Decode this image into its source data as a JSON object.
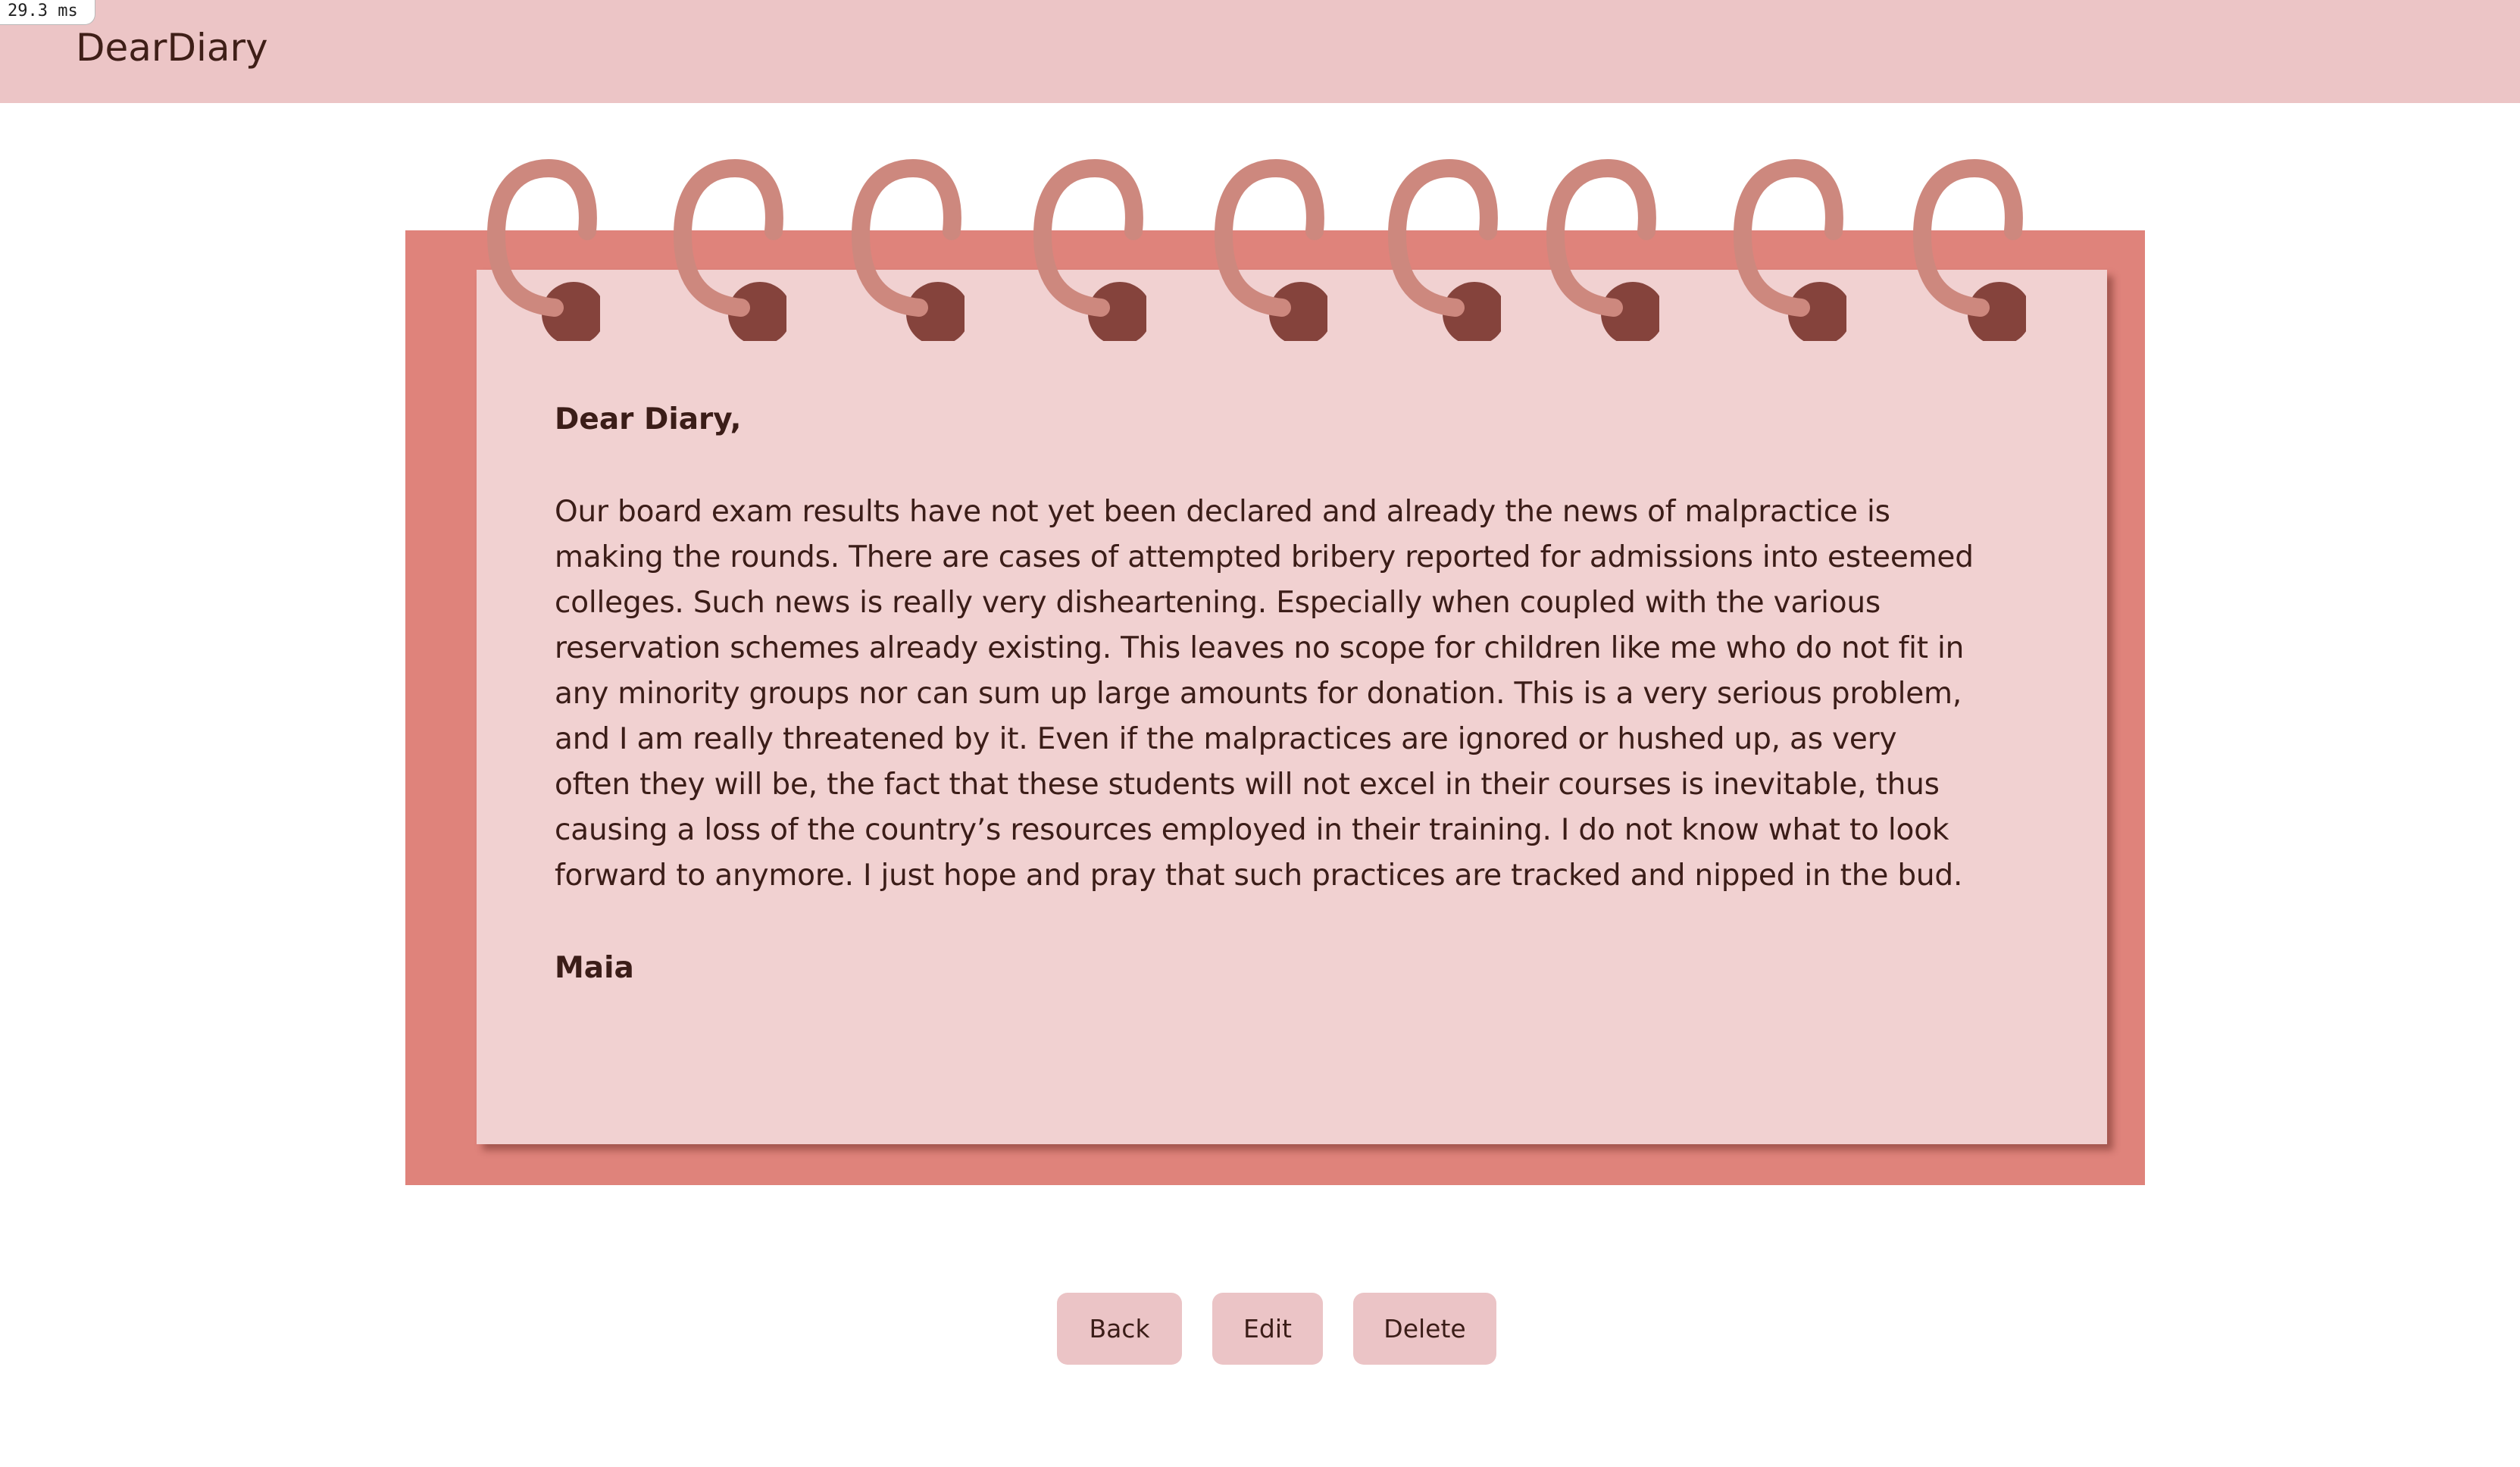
{
  "perf": {
    "value": "29.3",
    "unit": "ms"
  },
  "header": {
    "brand": "DearDiary"
  },
  "entry": {
    "salutation": "Dear Diary,",
    "body": "Our board exam results have not yet been declared and already the news of malpractice is making the rounds. There are cases of attempted bribery reported for admissions into esteemed colleges. Such news is really very disheartening. Especially when coupled with the various reservation schemes already existing. This leaves no scope for children like me who do not fit in any minority groups nor can sum up large amounts for donation. This is a very serious problem, and I am really threatened by it. Even if the malpractices are ignored or hushed up, as very often they will be, the fact that these students will not excel in their courses is inevitable, thus causing a loss of the country’s resources employed in their training. I do not know what to look forward to anymore. I just hope and pray that such practices are tracked and nipped in the bud.",
    "signature": "Maia"
  },
  "actions": {
    "back": "Back",
    "edit": "Edit",
    "delete": "Delete"
  },
  "colors": {
    "header_bg": "#ecc5c6",
    "notebook_cover": "#df837b",
    "page_bg": "#f1d1d1",
    "ring": "#cd887e",
    "ring_hole": "#85433c",
    "text": "#3b1d18",
    "button_bg": "#ebc4c6"
  },
  "icons": {
    "ring": "spiral-binding-ring-icon"
  }
}
